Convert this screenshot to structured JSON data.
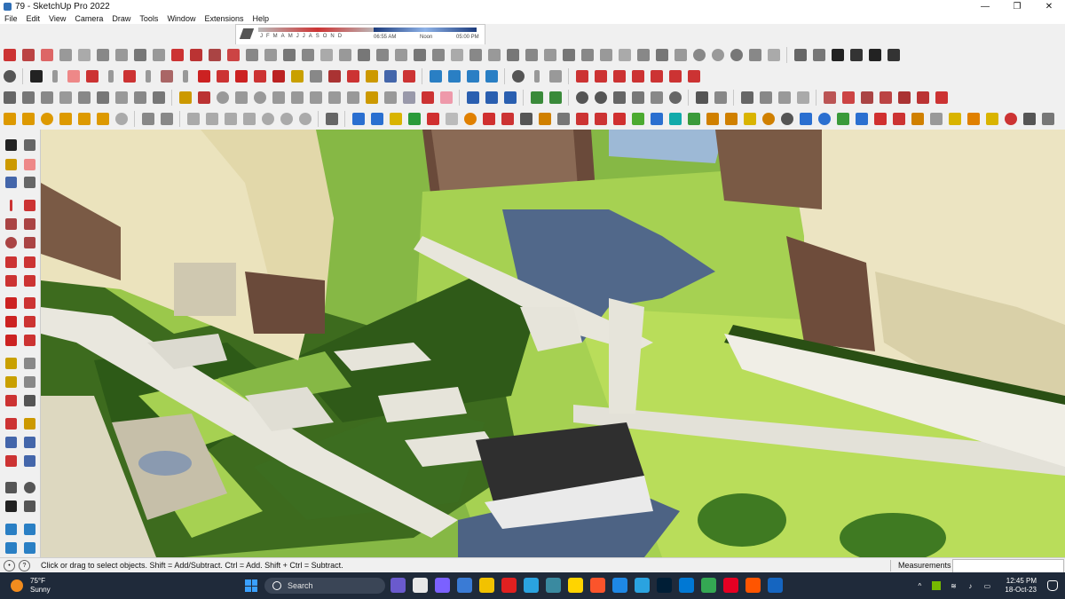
{
  "window": {
    "title": "79 - SketchUp Pro 2022",
    "minimize": "—",
    "maximize": "❐",
    "close": "✕"
  },
  "menu": [
    "File",
    "Edit",
    "View",
    "Camera",
    "Draw",
    "Tools",
    "Window",
    "Extensions",
    "Help"
  ],
  "shadow_settings": {
    "months": [
      "J",
      "F",
      "M",
      "A",
      "M",
      "J",
      "J",
      "A",
      "S",
      "O",
      "N",
      "D"
    ],
    "time_start": "06:55 AM",
    "time_noon": "Noon",
    "time_end": "05:00 PM"
  },
  "statusbar": {
    "hint": "Click or drag to select objects. Shift = Add/Subtract. Ctrl = Add. Shift + Ctrl = Subtract.",
    "measurements_label": "Measurements",
    "measurements_value": ""
  },
  "taskbar": {
    "temperature": "75°F",
    "condition": "Sunny",
    "search_placeholder": "Search",
    "time": "12:45 PM",
    "date": "18-Oct-23"
  }
}
